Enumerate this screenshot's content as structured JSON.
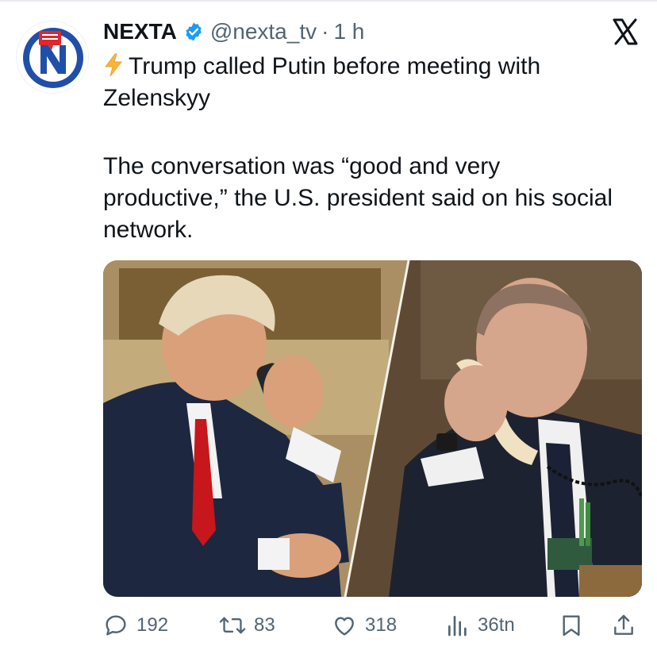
{
  "account": {
    "name": "NEXTA",
    "handle": "@nexta_tv",
    "separator": "·",
    "time": "1 h",
    "verified": true,
    "avatar_letter": "N"
  },
  "tweet": {
    "line1": "Trump called Putin before meeting with Zelenskyy",
    "line2": "The conversation was “good and very productive,” the U.S. president said on his social network.",
    "emoji_icon": "lightning-icon"
  },
  "media": {
    "type": "photo",
    "icon": "photo-icon"
  },
  "actions": {
    "replies": "192",
    "reposts": "83",
    "likes": "318",
    "views": "36tn"
  },
  "colors": {
    "text": "#0f1419",
    "muted": "#536471",
    "verified": "#1d9bf0",
    "brand_red": "#e2262a",
    "brand_blue": "#1f4fa8",
    "bolt": "#f9b43c"
  }
}
